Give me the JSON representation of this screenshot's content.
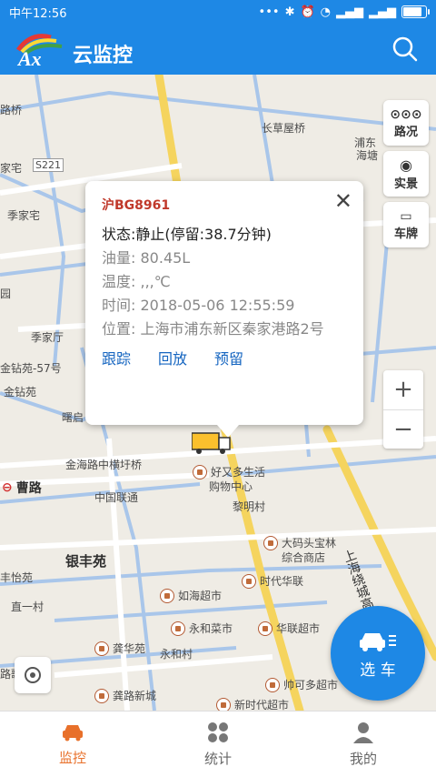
{
  "status": {
    "time": "中午12:56",
    "battery_level": 0.9
  },
  "header": {
    "title": "云监控",
    "logo_text": "Ax",
    "accent": "#1e88e5"
  },
  "map": {
    "places": [
      "路桥",
      "长草屋桥",
      "浦东",
      "海塘",
      "家宅",
      "S221",
      "季家宅",
      "园",
      "季家厅",
      "金钻苑-57号",
      "金钻苑",
      "曙启",
      "金海路中横圩桥",
      "曹路",
      "中国联通",
      "好又多生活",
      "购物中心",
      "黎明村",
      "银丰苑",
      "丰怡苑",
      "大码头宝林",
      "综合商店",
      "时代华联",
      "直一村",
      "如海超市",
      "永和菜市",
      "华联超市",
      "龚华苑",
      "永和村",
      "帅可多超市",
      "路歌剧院",
      "龚路新城",
      "新时代超市",
      "上海绕城高速"
    ],
    "side_buttons": [
      "路况",
      "实景",
      "车牌"
    ],
    "zoom": {
      "in": "+",
      "out": "−"
    }
  },
  "popup": {
    "plate": "沪BG8961",
    "status_label": "状态:",
    "status_value": "静止(停留:38.7分钟)",
    "oil_label": "油量:",
    "oil_value": "80.45L",
    "temp_label": "温度:",
    "temp_value": ",,,℃",
    "time_label": "时间:",
    "time_value": "2018-05-06 12:55:59",
    "location_label": "位置:",
    "location_value": "上海市浦东新区秦家港路2号",
    "actions": [
      "跟踪",
      "回放",
      "预留"
    ]
  },
  "fab": {
    "label": "选 车"
  },
  "tabs": [
    {
      "label": "监控",
      "icon": "car-icon",
      "active": true
    },
    {
      "label": "统计",
      "icon": "grid-icon",
      "active": false
    },
    {
      "label": "我的",
      "icon": "user-icon",
      "active": false
    }
  ]
}
